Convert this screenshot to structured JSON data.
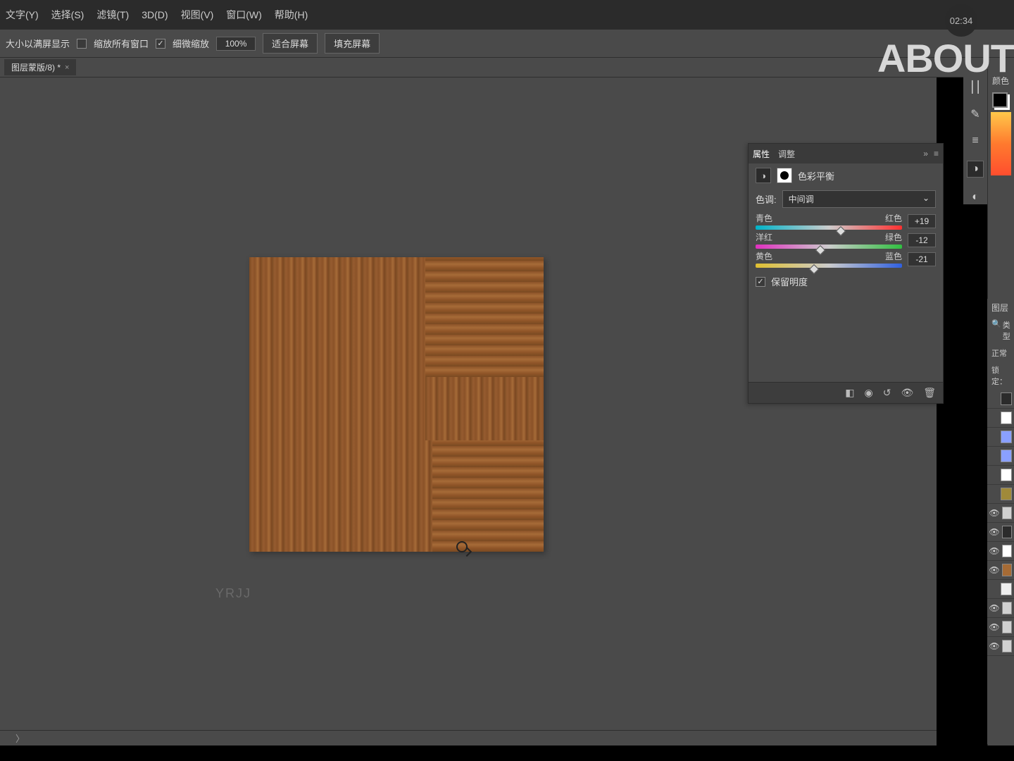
{
  "menu": {
    "items": [
      "文字(Y)",
      "选择(S)",
      "滤镜(T)",
      "3D(D)",
      "视图(V)",
      "窗口(W)",
      "帮助(H)"
    ]
  },
  "options": {
    "fit_label": "大小以满屏显示",
    "all_windows_label": "缩放所有窗口",
    "all_windows_checked": false,
    "fine_zoom_label": "细微缩放",
    "fine_zoom_checked": true,
    "zoom_value": "100%",
    "fit_screen": "适合屏幕",
    "fill_screen": "填充屏幕"
  },
  "doc_tab": {
    "name": "图层蒙版/8) *"
  },
  "watermark": "YRJJ",
  "brand": "ABOUT",
  "clock": "02:34",
  "panel": {
    "tabs": {
      "t1": "属性",
      "t2": "调整"
    },
    "collapse": "»",
    "menu_icon": "≡",
    "type_label": "色彩平衡",
    "tone_label": "色调:",
    "tone_value": "中间调",
    "sliders": [
      {
        "left": "青色",
        "right": "红色",
        "value": "+19",
        "pos": 58
      },
      {
        "left": "洋红",
        "right": "绿色",
        "value": "-12",
        "pos": 44
      },
      {
        "left": "黄色",
        "right": "蓝色",
        "value": "-21",
        "pos": 40
      }
    ],
    "preserve_lum": "保留明度",
    "preserve_checked": true
  },
  "right": {
    "color_label": "颜色",
    "layers_label": "图层",
    "filter_label": "类型",
    "blend_label": "正常",
    "lock_label": "锁定："
  },
  "layers": [
    {
      "eye": false,
      "bg": "#2b2b2b"
    },
    {
      "eye": false,
      "bg": "#ffffff"
    },
    {
      "eye": false,
      "bg": "#8aa0ff"
    },
    {
      "eye": false,
      "bg": "#8aa0ff"
    },
    {
      "eye": false,
      "bg": "#ffffff"
    },
    {
      "eye": false,
      "bg": "#a08a3a"
    },
    {
      "eye": true,
      "bg": "#d0d0d0"
    },
    {
      "eye": true,
      "bg": "#2b2b2b"
    },
    {
      "eye": true,
      "bg": "#ffffff"
    },
    {
      "eye": true,
      "bg": "#a66b35"
    },
    {
      "eye": false,
      "bg": "#eeeeee"
    },
    {
      "eye": true,
      "bg": "#d0d0d0"
    },
    {
      "eye": true,
      "bg": "#d0d0d0"
    },
    {
      "eye": true,
      "bg": "#d0d0d0"
    }
  ],
  "status": {
    "expand": "〉"
  }
}
